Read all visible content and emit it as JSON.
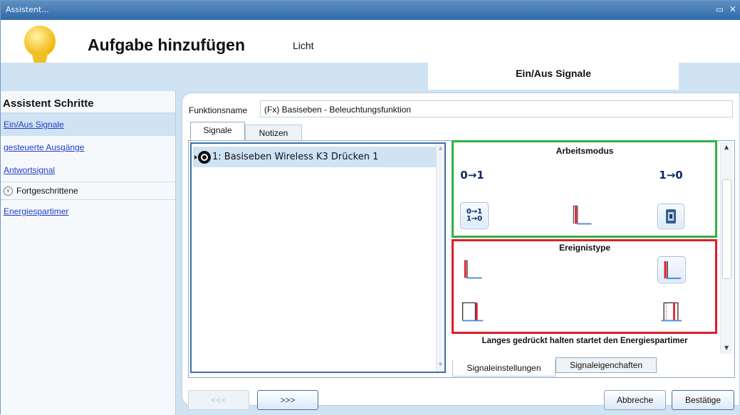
{
  "window": {
    "title": "Assistent..."
  },
  "header": {
    "title": "Aufgabe hinzufügen",
    "subtitle": "Licht",
    "section_tab": "Ein/Aus Signale"
  },
  "sidebar": {
    "heading": "Assistent Schritte",
    "steps": [
      {
        "label": "Ein/Aus Signale",
        "active": true
      },
      {
        "label": "gesteuerte Ausgänge",
        "active": false
      },
      {
        "label": "Antwortsignal",
        "active": false
      }
    ],
    "advanced": {
      "label": "Fortgeschrittene"
    },
    "extra_steps": [
      {
        "label": "Energiespartimer"
      }
    ]
  },
  "function": {
    "label": "Funktionsname",
    "value": "(Fx) Basiseben - Beleuchtungsfunktion"
  },
  "tabs": [
    {
      "label": "Signale",
      "selected": true
    },
    {
      "label": "Notizen",
      "selected": false
    }
  ],
  "signals": [
    {
      "label": "1: Basiseben Wireless K3 Drücken 1",
      "selected": true
    }
  ],
  "settings": {
    "arbeitsmodus": {
      "title": "Arbeitsmodus",
      "icons": [
        "0→1",
        "1→0",
        "0→1 1→0",
        "pulse-edge-icon",
        "remote-device-icon"
      ]
    },
    "ereignistype": {
      "title": "Ereignistype",
      "icons": [
        "rising-edge-icon",
        "rising-edge-selected-icon",
        "falling-edge-icon",
        "pulse-icon"
      ]
    },
    "long_press": {
      "title": "Langes gedrückt halten startet den Energiespartimer"
    },
    "highlight_colors": {
      "arbeitsmodus": "#2fb143",
      "ereignistype": "#e11b2b"
    }
  },
  "bottom_tabs": [
    {
      "label": "Signaleinstellungen",
      "selected": true
    },
    {
      "label": "Signaleigenchaften",
      "selected": false
    }
  ],
  "buttons": {
    "prev": "<<<",
    "next": ">>>",
    "cancel": "Abbreche",
    "ok": "Bestätige"
  }
}
